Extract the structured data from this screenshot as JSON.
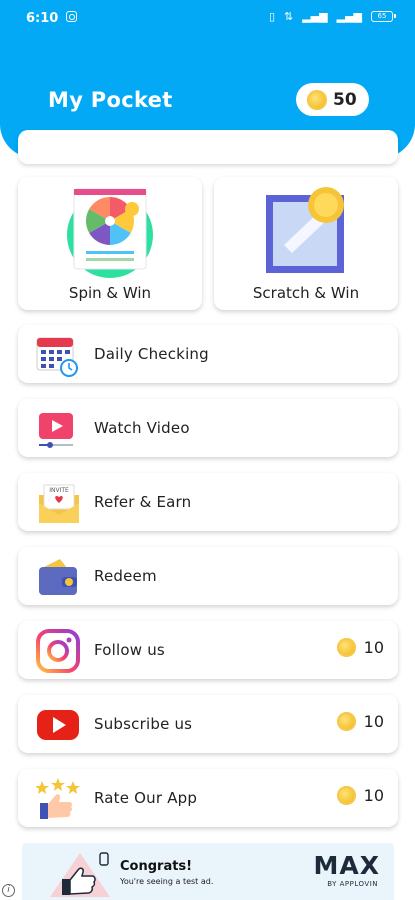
{
  "status_bar": {
    "time": "6:10",
    "battery": "65"
  },
  "header": {
    "title": "My Pocket",
    "coins": "50"
  },
  "tiles": [
    {
      "label": "Spin & Win",
      "icon": "spin-wheel-icon"
    },
    {
      "label": "Scratch & Win",
      "icon": "scratch-card-icon"
    }
  ],
  "rows": [
    {
      "label": "Daily Checking",
      "icon": "calendar-icon",
      "reward": ""
    },
    {
      "label": "Watch Video",
      "icon": "video-player-icon",
      "reward": ""
    },
    {
      "label": "Refer & Earn",
      "icon": "invite-envelope-icon",
      "reward": ""
    },
    {
      "label": "Redeem",
      "icon": "wallet-icon",
      "reward": ""
    },
    {
      "label": "Follow us",
      "icon": "instagram-icon",
      "reward": "10"
    },
    {
      "label": "Subscribe us",
      "icon": "youtube-icon",
      "reward": "10"
    },
    {
      "label": "Rate Our App",
      "icon": "thumbs-up-stars-icon",
      "reward": "10"
    }
  ],
  "ad": {
    "title": "Congrats!",
    "subtitle": "You're seeing a test ad.",
    "brand": "MAX",
    "brand_by": "BY APPLOVIN",
    "info": "i"
  },
  "colors": {
    "header": "#03A9F4",
    "coin": "#F6C437",
    "youtube": "#E62117"
  }
}
